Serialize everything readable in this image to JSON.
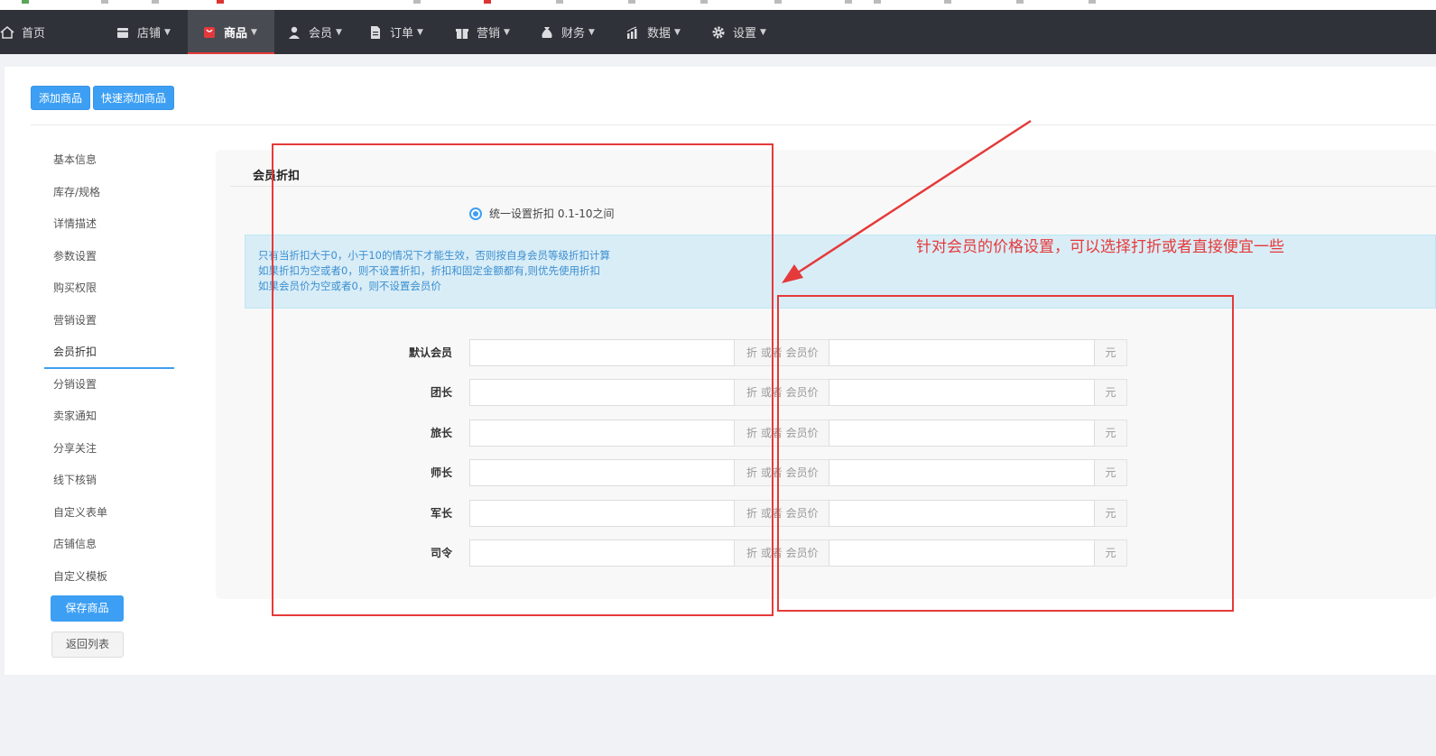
{
  "nav": {
    "items": [
      {
        "label": "首页",
        "icon": "home-icon"
      },
      {
        "label": "店铺",
        "icon": "store-icon"
      },
      {
        "label": "商品",
        "icon": "goods-icon"
      },
      {
        "label": "会员",
        "icon": "user-icon"
      },
      {
        "label": "订单",
        "icon": "document-icon"
      },
      {
        "label": "营销",
        "icon": "gift-icon"
      },
      {
        "label": "财务",
        "icon": "money-bag-icon"
      },
      {
        "label": "数据",
        "icon": "bar-chart-icon"
      },
      {
        "label": "设置",
        "icon": "gear-icon"
      }
    ],
    "active_index": 2
  },
  "toolbar": {
    "add_goods": "添加商品",
    "quick_add_goods": "快速添加商品"
  },
  "sidebar": {
    "items": [
      {
        "label": "基本信息"
      },
      {
        "label": "库存/规格"
      },
      {
        "label": "详情描述"
      },
      {
        "label": "参数设置"
      },
      {
        "label": "购买权限"
      },
      {
        "label": "营销设置"
      },
      {
        "label": "会员折扣"
      },
      {
        "label": "分销设置"
      },
      {
        "label": "卖家通知"
      },
      {
        "label": "分享关注"
      },
      {
        "label": "线下核销"
      },
      {
        "label": "自定义表单"
      },
      {
        "label": "店铺信息"
      },
      {
        "label": "自定义模板"
      }
    ],
    "active_index": 6,
    "save_label": "保存商品",
    "back_label": "返回列表"
  },
  "section": {
    "title": "会员折扣",
    "radio_label": "统一设置折扣 0.1-10之间",
    "alert_lines": [
      "只有当折扣大于0，小于10的情况下才能生效，否则按自身会员等级折扣计算",
      "如果折扣为空或者0，则不设置折扣，折扣和固定金额都有,则优先使用折扣",
      "如果会员价为空或者0，则不设置会员价"
    ],
    "addon_discount": "折 或者 会员价",
    "addon_currency": "元",
    "levels": [
      {
        "label": "默认会员",
        "discount": "",
        "price": ""
      },
      {
        "label": "团长",
        "discount": "",
        "price": ""
      },
      {
        "label": "旅长",
        "discount": "",
        "price": ""
      },
      {
        "label": "师长",
        "discount": "",
        "price": ""
      },
      {
        "label": "军长",
        "discount": "",
        "price": ""
      },
      {
        "label": "司令",
        "discount": "",
        "price": ""
      }
    ]
  },
  "annotation": {
    "text": "针对会员的价格设置，可以选择打折或者直接便宜一些",
    "color": "#e53a3a"
  },
  "colors": {
    "accent": "#3d9ff3",
    "navbar": "#2f3238",
    "active_underline": "#e4393c"
  }
}
